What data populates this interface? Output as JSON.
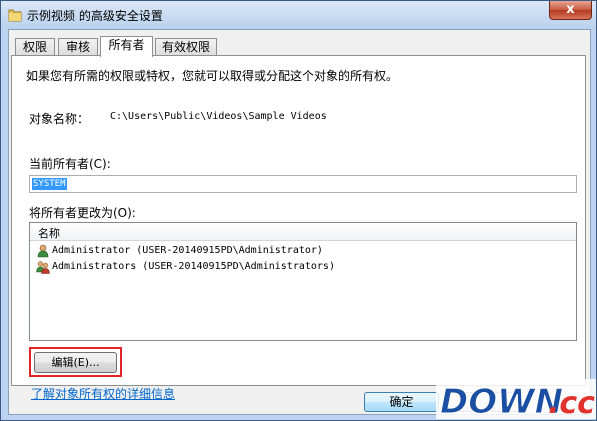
{
  "window": {
    "title": "示例视频 的高级安全设置",
    "close_glyph": "x"
  },
  "tabs": [
    {
      "label": "权限"
    },
    {
      "label": "审核"
    },
    {
      "label": "所有者"
    },
    {
      "label": "有效权限"
    }
  ],
  "owner_panel": {
    "intro": "如果您有所需的权限或特权，您就可以取得或分配这个对象的所有权。",
    "object_name_label": "对象名称：",
    "object_name_value": "C:\\Users\\Public\\Videos\\Sample Videos",
    "current_owner_label": "当前所有者(C):",
    "current_owner_value": "SYSTEM",
    "change_owner_label": "将所有者更改为(O):",
    "list_header": "名称",
    "owners": [
      {
        "label": "Administrator (USER-20140915PD\\Administrator)",
        "icon": "user-icon"
      },
      {
        "label": "Administrators (USER-20140915PD\\Administrators)",
        "icon": "user-group-icon"
      }
    ],
    "edit_button": "编辑(E)...",
    "learn_more_link": "了解对象所有权的详细信息"
  },
  "footer": {
    "ok_button": "确定"
  },
  "watermark": {
    "text": "DOWN.cc"
  }
}
